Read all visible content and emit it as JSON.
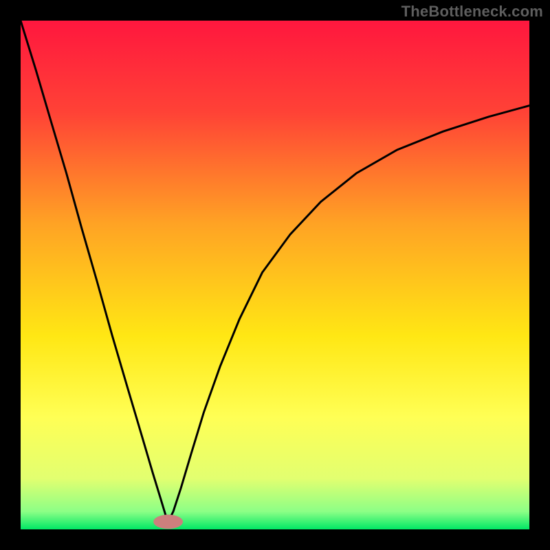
{
  "watermark": "TheBottleneck.com",
  "chart_data": {
    "type": "line",
    "title": "",
    "xlabel": "",
    "ylabel": "",
    "ylim": [
      0,
      100
    ],
    "xlim": [
      0,
      100
    ],
    "background_gradient": {
      "stops": [
        {
          "offset": 0.0,
          "color": "#ff173e"
        },
        {
          "offset": 0.18,
          "color": "#ff4236"
        },
        {
          "offset": 0.4,
          "color": "#ffa324"
        },
        {
          "offset": 0.62,
          "color": "#ffe714"
        },
        {
          "offset": 0.78,
          "color": "#ffff55"
        },
        {
          "offset": 0.9,
          "color": "#e2ff70"
        },
        {
          "offset": 0.965,
          "color": "#8cff86"
        },
        {
          "offset": 1.0,
          "color": "#00e765"
        }
      ]
    },
    "marker": {
      "x": 29,
      "y": 1.5,
      "rx": 2.9,
      "ry": 1.4,
      "color": "#cc7f7d"
    },
    "series": [
      {
        "name": "left-branch",
        "x": [
          0.0,
          3.0,
          6.0,
          9.0,
          12.0,
          15.0,
          18.0,
          21.0,
          24.0,
          26.0,
          27.5,
          28.5,
          29.0
        ],
        "values": [
          100,
          90.3,
          80.1,
          70.0,
          59.2,
          48.8,
          38.1,
          27.9,
          17.8,
          11.0,
          6.1,
          2.8,
          1.5
        ]
      },
      {
        "name": "right-branch",
        "x": [
          29.0,
          30.0,
          31.5,
          33.5,
          36.0,
          39.2,
          43.0,
          47.5,
          53.0,
          59.0,
          66.0,
          74.0,
          83.0,
          92.0,
          100.0
        ],
        "values": [
          1.5,
          3.5,
          8.1,
          14.8,
          23.0,
          32.0,
          41.3,
          50.5,
          58.0,
          64.4,
          70.0,
          74.6,
          78.2,
          81.1,
          83.3
        ]
      }
    ]
  }
}
